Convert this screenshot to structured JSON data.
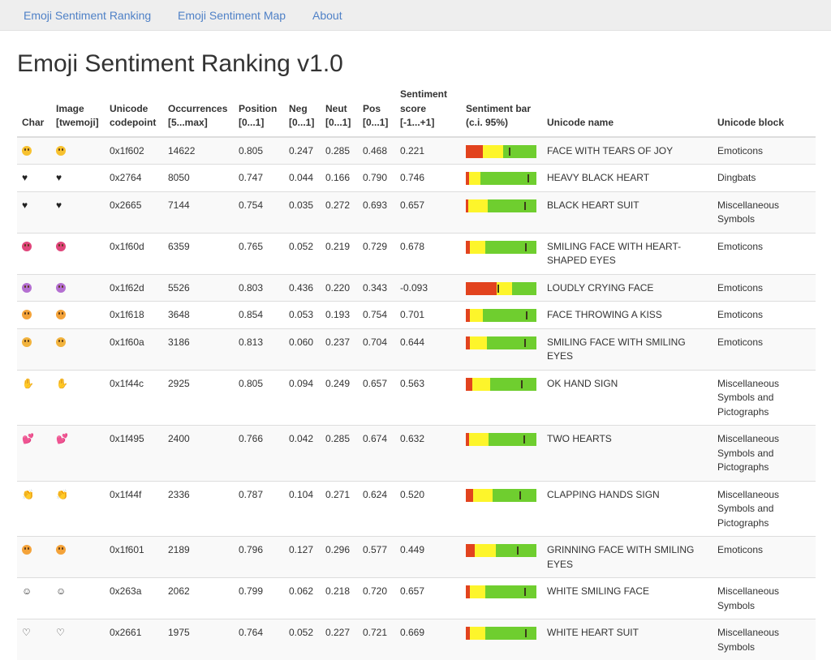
{
  "nav": {
    "items": [
      "Emoji Sentiment Ranking",
      "Emoji Sentiment Map",
      "About"
    ]
  },
  "title": "Emoji Sentiment Ranking v1.0",
  "columns": {
    "char": "Char",
    "image_l1": "Image",
    "image_l2": "[twemoji]",
    "unicode_l1": "Unicode",
    "unicode_l2": "codepoint",
    "occ_l1": "Occurrences",
    "occ_l2": "[5...max]",
    "position_l1": "Position",
    "position_l2": "[0...1]",
    "neg_l1": "Neg",
    "neg_l2": "[0...1]",
    "neut_l1": "Neut",
    "neut_l2": "[0...1]",
    "pos_l1": "Pos",
    "pos_l2": "[0...1]",
    "score_l1": "Sentiment",
    "score_l2": "score",
    "score_l3": "[-1...+1]",
    "bar_l1": "Sentiment bar",
    "bar_l2": "(c.i. 95%)",
    "name": "Unicode name",
    "block": "Unicode block"
  },
  "colors": {
    "negative": "#e2431e",
    "neutral": "#fdf52b",
    "positive": "#6fce2f",
    "link": "#4f81c7"
  },
  "rows": [
    {
      "icon": "face-with-tears-of-joy-icon",
      "shape": "face",
      "color": "#f7c12f",
      "codepoint": "0x1f602",
      "occurrences": "14622",
      "position": "0.805",
      "neg": "0.247",
      "neut": "0.285",
      "pos": "0.468",
      "score": "0.221",
      "negv": 0.247,
      "neutv": 0.285,
      "posv": 0.468,
      "markv": 0.61,
      "name": "FACE WITH TEARS OF JOY",
      "block": "Emoticons"
    },
    {
      "icon": "heavy-black-heart-icon",
      "shape": "heart",
      "glyph": "♥",
      "color": "#222222",
      "codepoint": "0x2764",
      "occurrences": "8050",
      "position": "0.747",
      "neg": "0.044",
      "neut": "0.166",
      "pos": "0.790",
      "score": "0.746",
      "negv": 0.044,
      "neutv": 0.166,
      "posv": 0.79,
      "markv": 0.873,
      "name": "HEAVY BLACK HEART",
      "block": "Dingbats"
    },
    {
      "icon": "black-heart-suit-icon",
      "shape": "heart",
      "glyph": "♥",
      "color": "#222222",
      "codepoint": "0x2665",
      "occurrences": "7144",
      "position": "0.754",
      "neg": "0.035",
      "neut": "0.272",
      "pos": "0.693",
      "score": "0.657",
      "negv": 0.035,
      "neutv": 0.272,
      "posv": 0.693,
      "markv": 0.829,
      "name": "BLACK HEART SUIT",
      "block": "Miscellaneous Symbols"
    },
    {
      "icon": "smiling-face-with-heart-shaped-eyes-icon",
      "shape": "face",
      "color": "#e0457b",
      "codepoint": "0x1f60d",
      "occurrences": "6359",
      "position": "0.765",
      "neg": "0.052",
      "neut": "0.219",
      "pos": "0.729",
      "score": "0.678",
      "negv": 0.052,
      "neutv": 0.219,
      "posv": 0.729,
      "markv": 0.839,
      "name": "SMILING FACE WITH HEART-SHAPED EYES",
      "block": "Emoticons"
    },
    {
      "icon": "loudly-crying-face-icon",
      "shape": "face",
      "color": "#b46fd1",
      "codepoint": "0x1f62d",
      "occurrences": "5526",
      "position": "0.803",
      "neg": "0.436",
      "neut": "0.220",
      "pos": "0.343",
      "score": "-0.093",
      "negv": 0.436,
      "neutv": 0.22,
      "posv": 0.343,
      "markv": 0.454,
      "name": "LOUDLY CRYING FACE",
      "block": "Emoticons"
    },
    {
      "icon": "face-throwing-a-kiss-icon",
      "shape": "face",
      "color": "#f4a33a",
      "codepoint": "0x1f618",
      "occurrences": "3648",
      "position": "0.854",
      "neg": "0.053",
      "neut": "0.193",
      "pos": "0.754",
      "score": "0.701",
      "negv": 0.053,
      "neutv": 0.193,
      "posv": 0.754,
      "markv": 0.851,
      "name": "FACE THROWING A KISS",
      "block": "Emoticons"
    },
    {
      "icon": "smiling-face-with-smiling-eyes-icon",
      "shape": "face",
      "color": "#f2b33d",
      "codepoint": "0x1f60a",
      "occurrences": "3186",
      "position": "0.813",
      "neg": "0.060",
      "neut": "0.237",
      "pos": "0.704",
      "score": "0.644",
      "negv": 0.06,
      "neutv": 0.237,
      "posv": 0.704,
      "markv": 0.822,
      "name": "SMILING FACE WITH SMILING EYES",
      "block": "Emoticons"
    },
    {
      "icon": "ok-hand-sign-icon",
      "shape": "hand",
      "glyph": "✋",
      "color": "#f3c14d",
      "codepoint": "0x1f44c",
      "occurrences": "2925",
      "position": "0.805",
      "neg": "0.094",
      "neut": "0.249",
      "pos": "0.657",
      "score": "0.563",
      "negv": 0.094,
      "neutv": 0.249,
      "posv": 0.657,
      "markv": 0.782,
      "name": "OK HAND SIGN",
      "block": "Miscellaneous Symbols and Pictographs"
    },
    {
      "icon": "two-hearts-icon",
      "shape": "heart",
      "glyph": "💕",
      "color": "#e0457b",
      "codepoint": "0x1f495",
      "occurrences": "2400",
      "position": "0.766",
      "neg": "0.042",
      "neut": "0.285",
      "pos": "0.674",
      "score": "0.632",
      "negv": 0.042,
      "neutv": 0.285,
      "posv": 0.674,
      "markv": 0.816,
      "name": "TWO HEARTS",
      "block": "Miscellaneous Symbols and Pictographs"
    },
    {
      "icon": "clapping-hands-sign-icon",
      "shape": "hand",
      "glyph": "👏",
      "color": "#f2b33d",
      "codepoint": "0x1f44f",
      "occurrences": "2336",
      "position": "0.787",
      "neg": "0.104",
      "neut": "0.271",
      "pos": "0.624",
      "score": "0.520",
      "negv": 0.104,
      "neutv": 0.271,
      "posv": 0.624,
      "markv": 0.76,
      "name": "CLAPPING HANDS SIGN",
      "block": "Miscellaneous Symbols and Pictographs"
    },
    {
      "icon": "grinning-face-with-smiling-eyes-icon",
      "shape": "face",
      "color": "#f4a33a",
      "codepoint": "0x1f601",
      "occurrences": "2189",
      "position": "0.796",
      "neg": "0.127",
      "neut": "0.296",
      "pos": "0.577",
      "score": "0.449",
      "negv": 0.127,
      "neutv": 0.296,
      "posv": 0.577,
      "markv": 0.725,
      "name": "GRINNING FACE WITH SMILING EYES",
      "block": "Emoticons"
    },
    {
      "icon": "white-smiling-face-icon",
      "shape": "glyph",
      "glyph": "☺",
      "color": "#333333",
      "codepoint": "0x263a",
      "occurrences": "2062",
      "position": "0.799",
      "neg": "0.062",
      "neut": "0.218",
      "pos": "0.720",
      "score": "0.657",
      "negv": 0.062,
      "neutv": 0.218,
      "posv": 0.72,
      "markv": 0.829,
      "name": "WHITE SMILING FACE",
      "block": "Miscellaneous Symbols"
    },
    {
      "icon": "white-heart-suit-icon",
      "shape": "glyph",
      "glyph": "♡",
      "color": "#333333",
      "codepoint": "0x2661",
      "occurrences": "1975",
      "position": "0.764",
      "neg": "0.052",
      "neut": "0.227",
      "pos": "0.721",
      "score": "0.669",
      "negv": 0.052,
      "neutv": 0.227,
      "posv": 0.721,
      "markv": 0.835,
      "name": "WHITE HEART SUIT",
      "block": "Miscellaneous Symbols"
    }
  ]
}
